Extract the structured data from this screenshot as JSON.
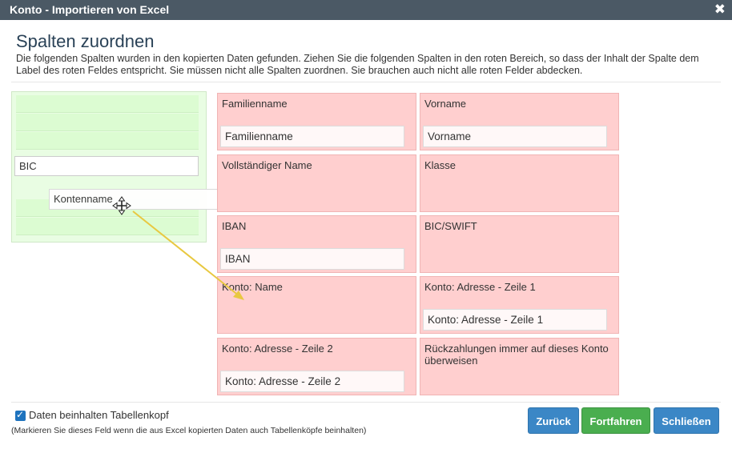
{
  "window": {
    "title": "Konto - Importieren von Excel",
    "close_glyph": "✖"
  },
  "heading": "Spalten zuordnen",
  "description": "Die folgenden Spalten wurden in den kopierten Daten gefunden. Ziehen Sie die folgenden Spalten in den roten Bereich, so dass der Inhalt der Spalte dem Label des roten Feldes entspricht. Sie müssen nicht alle Spalten zuordnen. Sie brauchen auch nicht alle roten Felder abdecken.",
  "source_columns": [
    {
      "label": "BIC"
    },
    {
      "label": "Kontenname",
      "state": "dragging"
    }
  ],
  "targets": [
    {
      "label": "Familienname",
      "assigned": "Familienname"
    },
    {
      "label": "Vorname",
      "assigned": "Vorname"
    },
    {
      "label": "Vollständiger Name",
      "assigned": null
    },
    {
      "label": "Klasse",
      "assigned": null
    },
    {
      "label": "IBAN",
      "assigned": "IBAN"
    },
    {
      "label": "BIC/SWIFT",
      "assigned": null
    },
    {
      "label": "Konto: Name",
      "assigned": null
    },
    {
      "label": "Konto: Adresse - Zeile 1",
      "assigned": "Konto: Adresse - Zeile 1"
    },
    {
      "label": "Konto: Adresse - Zeile 2",
      "assigned": "Konto: Adresse - Zeile 2"
    },
    {
      "label": "Rückzahlungen immer auf dieses Konto überweisen",
      "assigned": null
    }
  ],
  "footer": {
    "checkbox_label": "Daten beinhalten Tabellenkopf",
    "checkbox_checked": true,
    "hint": "(Markieren Sie dieses Feld wenn die aus Excel kopierten Daten auch Tabellenköpfe beinhalten)"
  },
  "buttons": {
    "back": "Zurück",
    "next": "Fortfahren",
    "close": "Schließen"
  },
  "icons": {
    "close": "close-icon",
    "move_cursor": "move-cursor-icon",
    "drag_arrow": "drag-arrow-icon",
    "checkmark": "checkmark-icon"
  },
  "colors": {
    "titlebar": "#4b5965",
    "target_bg": "#ffcfcf",
    "source_bg": "#e9fde3",
    "primary_button": "#3b87c6",
    "success_button": "#4aae4f",
    "drag_arrow": "#e8c840"
  }
}
